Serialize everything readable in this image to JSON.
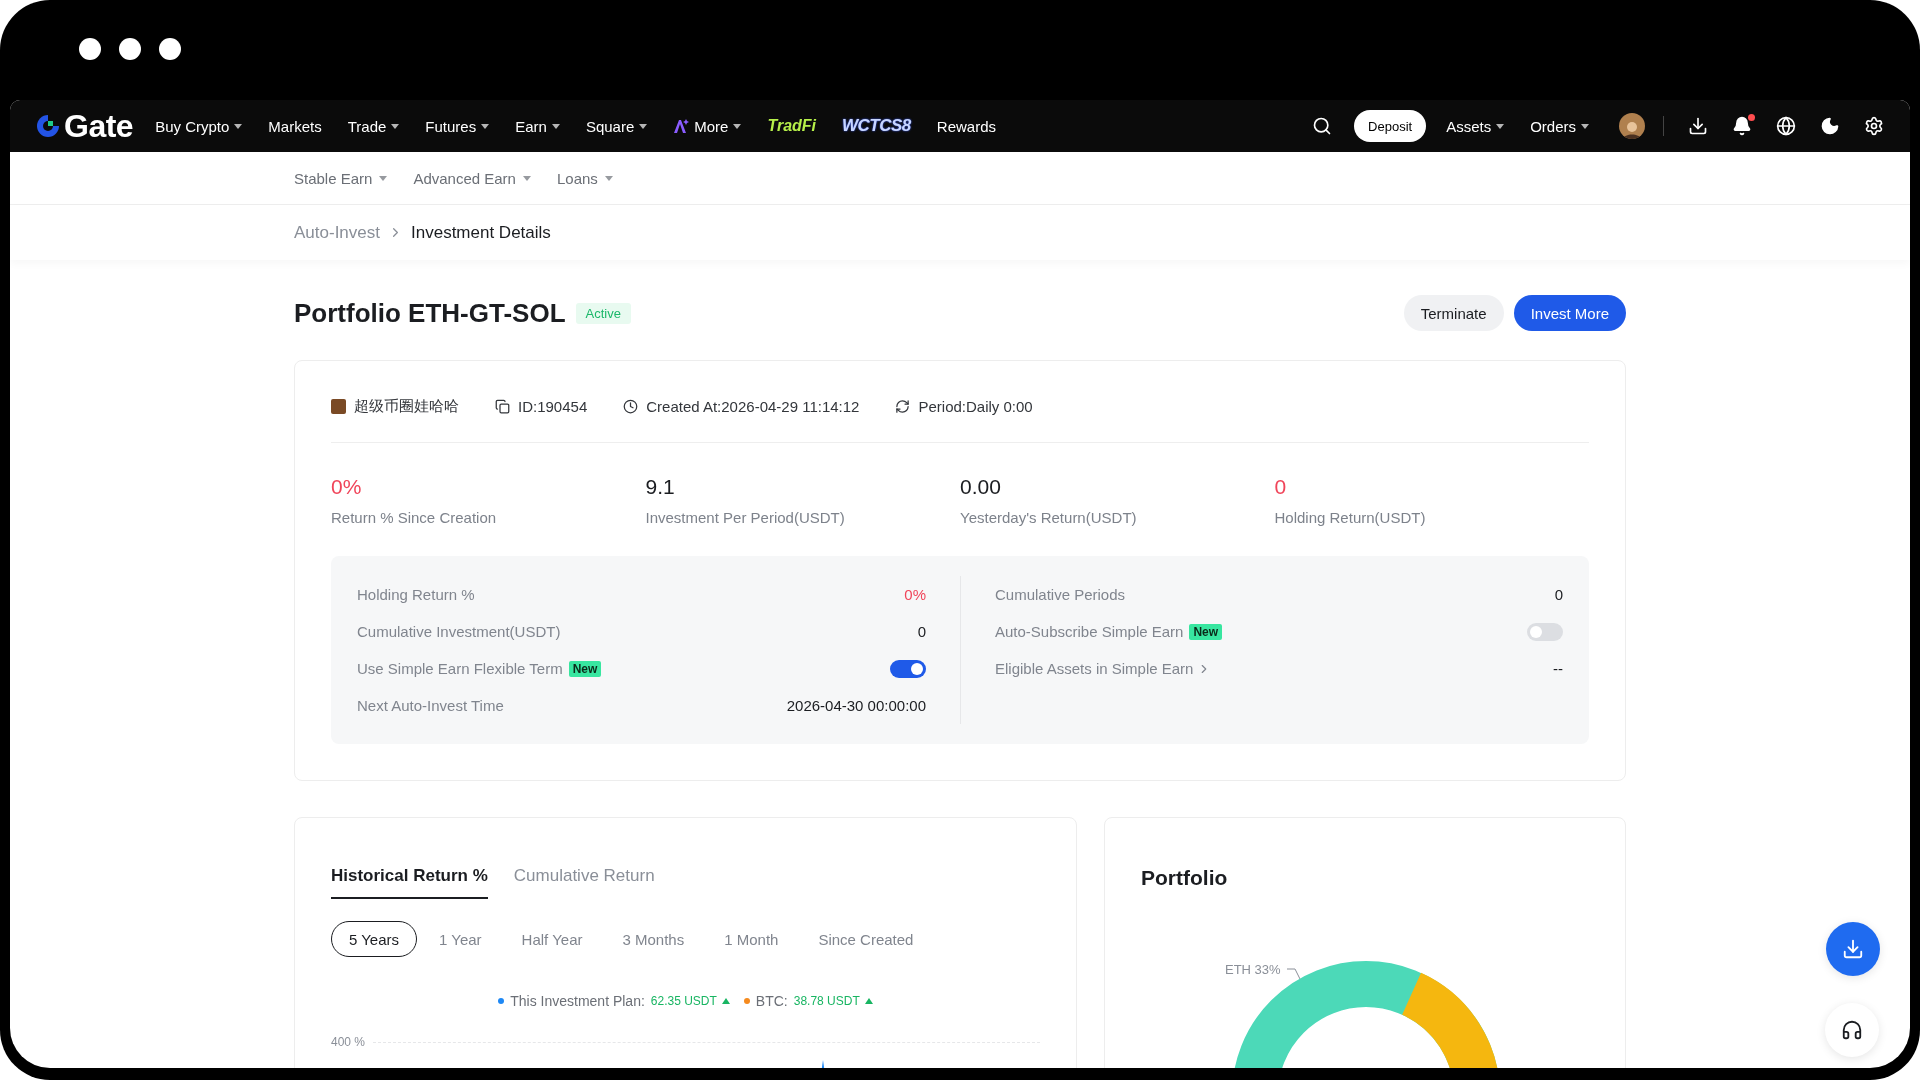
{
  "nav": {
    "logo": "Gate",
    "items": [
      {
        "label": "Buy Crypto",
        "kind": "menu"
      },
      {
        "label": "Markets",
        "kind": "plain"
      },
      {
        "label": "Trade",
        "kind": "menu"
      },
      {
        "label": "Futures",
        "kind": "menu"
      },
      {
        "label": "Earn",
        "kind": "menu"
      },
      {
        "label": "Square",
        "kind": "menu"
      },
      {
        "label": "More",
        "kind": "ai"
      },
      {
        "label": "TradFi",
        "kind": "tradfi"
      },
      {
        "label": "WCTCS8",
        "kind": "event"
      },
      {
        "label": "Rewards",
        "kind": "plain"
      }
    ],
    "deposit": "Deposit",
    "menus": [
      "Assets",
      "Orders"
    ],
    "unread": true
  },
  "subnav": [
    "Stable Earn",
    "Advanced Earn",
    "Loans"
  ],
  "breadcrumb": [
    "Auto-Invest",
    "Investment Details"
  ],
  "title": "Portfolio ETH-GT-SOL",
  "status": "Active",
  "actions": [
    {
      "label": "Terminate",
      "kind": "secondary"
    },
    {
      "label": "Invest More",
      "kind": "primary"
    }
  ],
  "meta": [
    {
      "kind": "user",
      "text": "超级币圈娃哈哈"
    },
    {
      "kind": "id",
      "text": "ID:190454"
    },
    {
      "kind": "created",
      "text": "Created At:2026-04-29 11:14:12"
    },
    {
      "kind": "period",
      "text": "Period:Daily 0:00"
    }
  ],
  "stats": [
    {
      "value": "0%",
      "label": "Return % Since Creation",
      "loss": true
    },
    {
      "value": "9.1",
      "label": "Investment Per Period(USDT)",
      "loss": false
    },
    {
      "value": "0.00",
      "label": "Yesterday's Return(USDT)",
      "loss": false
    },
    {
      "value": "0",
      "label": "Holding Return(USDT)",
      "loss": true
    }
  ],
  "details_left": [
    {
      "kind": "value",
      "label": "Holding Return %",
      "value": "0%",
      "loss": true
    },
    {
      "kind": "value",
      "label": "Cumulative Investment(USDT)",
      "value": "0",
      "loss": false
    },
    {
      "kind": "toggle",
      "label": "Use Simple Earn Flexible Term",
      "badge": "New",
      "on": true
    },
    {
      "kind": "value",
      "label": "Next Auto-Invest Time",
      "value": "2026-04-30 00:00:00",
      "loss": false
    }
  ],
  "details_right": [
    {
      "kind": "value",
      "label": "Cumulative Periods",
      "value": "0",
      "loss": false
    },
    {
      "kind": "toggle",
      "label": "Auto-Subscribe Simple Earn",
      "badge": "New",
      "on": false
    },
    {
      "kind": "link",
      "label": "Eligible Assets in Simple Earn",
      "value": "--",
      "loss": false
    }
  ],
  "history": {
    "tabs": [
      {
        "label": "Historical Return %",
        "selected": true
      },
      {
        "label": "Cumulative Return",
        "selected": false
      }
    ],
    "ranges": [
      {
        "label": "5 Years",
        "selected": true
      },
      {
        "label": "1 Year",
        "selected": false
      },
      {
        "label": "Half Year",
        "selected": false
      },
      {
        "label": "3 Months",
        "selected": false
      },
      {
        "label": "1 Month",
        "selected": false
      },
      {
        "label": "Since Created",
        "selected": false
      }
    ],
    "legend": [
      {
        "name": "This Investment Plan:",
        "value": "62.35 USDT",
        "color": "#1e88f5"
      },
      {
        "name": "BTC:",
        "value": "38.78 USDT",
        "color": "#f58a1e"
      }
    ],
    "ytick": "400 %"
  },
  "portfolio": {
    "title": "Portfolio",
    "slice_label": "ETH 33%"
  }
}
